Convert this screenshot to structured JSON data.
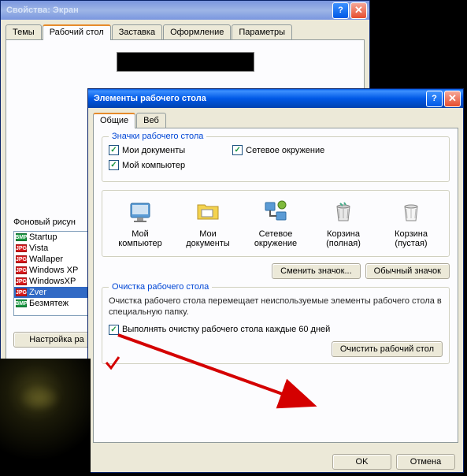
{
  "win1": {
    "title": "Свойства: Экран",
    "tabs": [
      "Темы",
      "Рабочий стол",
      "Заставка",
      "Оформление",
      "Параметры"
    ],
    "activeTab": 1,
    "bg_label": "Фоновый рисун",
    "bg_items": [
      {
        "type": "bmp",
        "label": "Startup"
      },
      {
        "type": "jpg",
        "label": "Vista"
      },
      {
        "type": "jpg",
        "label": "Wallaper"
      },
      {
        "type": "jpg",
        "label": "Windows XP"
      },
      {
        "type": "jpg",
        "label": "WindowsXP"
      },
      {
        "type": "jpg",
        "label": "Zver"
      },
      {
        "type": "bmp",
        "label": "Безмятеж"
      }
    ],
    "selectedIndex": 5,
    "customize_btn": "Настройка ра"
  },
  "win2": {
    "title": "Элементы рабочего стола",
    "tabs": [
      "Общие",
      "Веб"
    ],
    "activeTab": 0,
    "fieldset1_title": "Значки рабочего стола",
    "checks": {
      "mydocs": "Мои документы",
      "network": "Сетевое окружение",
      "mycomp": "Мой компьютер"
    },
    "icons": [
      {
        "name": "Мой компьютер"
      },
      {
        "name": "Мои документы"
      },
      {
        "name": "Сетевое окружение"
      },
      {
        "name": "Корзина (полная)"
      },
      {
        "name": "Корзина (пустая)"
      }
    ],
    "change_icon_btn": "Сменить значок...",
    "default_icon_btn": "Обычный значок",
    "fieldset2_title": "Очистка рабочего стола",
    "cleanup_text": "Очистка рабочего стола перемещает неиспользуемые элементы рабочего стола в специальную папку.",
    "cleanup_check": "Выполнять очистку рабочего стола каждые 60 дней",
    "cleanup_btn": "Очистить рабочий стол",
    "ok_btn": "OK",
    "cancel_btn": "Отмена"
  }
}
